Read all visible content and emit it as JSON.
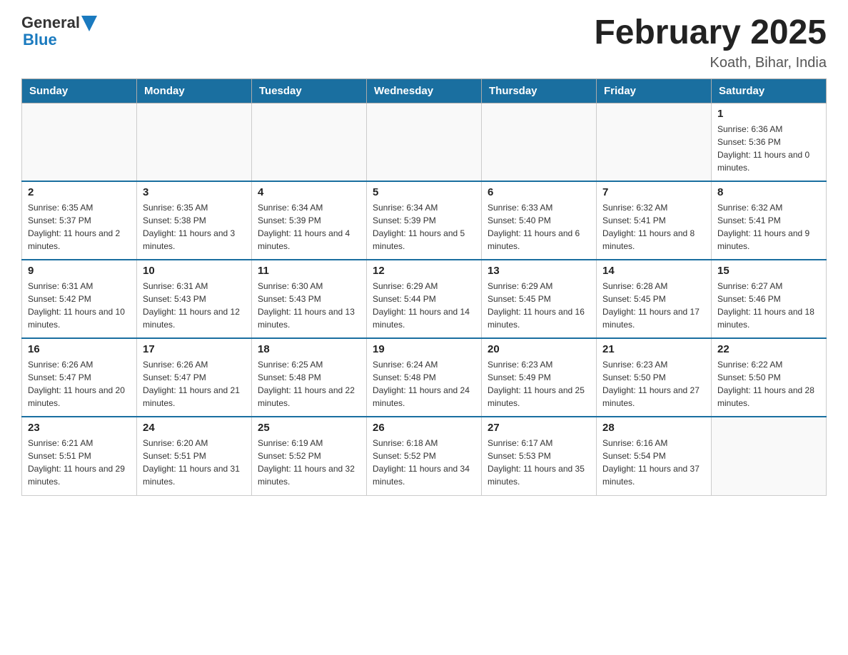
{
  "header": {
    "logo_general": "General",
    "logo_blue": "Blue",
    "month_title": "February 2025",
    "location": "Koath, Bihar, India"
  },
  "weekdays": [
    "Sunday",
    "Monday",
    "Tuesday",
    "Wednesday",
    "Thursday",
    "Friday",
    "Saturday"
  ],
  "weeks": [
    [
      {
        "day": "",
        "sunrise": "",
        "sunset": "",
        "daylight": ""
      },
      {
        "day": "",
        "sunrise": "",
        "sunset": "",
        "daylight": ""
      },
      {
        "day": "",
        "sunrise": "",
        "sunset": "",
        "daylight": ""
      },
      {
        "day": "",
        "sunrise": "",
        "sunset": "",
        "daylight": ""
      },
      {
        "day": "",
        "sunrise": "",
        "sunset": "",
        "daylight": ""
      },
      {
        "day": "",
        "sunrise": "",
        "sunset": "",
        "daylight": ""
      },
      {
        "day": "1",
        "sunrise": "Sunrise: 6:36 AM",
        "sunset": "Sunset: 5:36 PM",
        "daylight": "Daylight: 11 hours and 0 minutes."
      }
    ],
    [
      {
        "day": "2",
        "sunrise": "Sunrise: 6:35 AM",
        "sunset": "Sunset: 5:37 PM",
        "daylight": "Daylight: 11 hours and 2 minutes."
      },
      {
        "day": "3",
        "sunrise": "Sunrise: 6:35 AM",
        "sunset": "Sunset: 5:38 PM",
        "daylight": "Daylight: 11 hours and 3 minutes."
      },
      {
        "day": "4",
        "sunrise": "Sunrise: 6:34 AM",
        "sunset": "Sunset: 5:39 PM",
        "daylight": "Daylight: 11 hours and 4 minutes."
      },
      {
        "day": "5",
        "sunrise": "Sunrise: 6:34 AM",
        "sunset": "Sunset: 5:39 PM",
        "daylight": "Daylight: 11 hours and 5 minutes."
      },
      {
        "day": "6",
        "sunrise": "Sunrise: 6:33 AM",
        "sunset": "Sunset: 5:40 PM",
        "daylight": "Daylight: 11 hours and 6 minutes."
      },
      {
        "day": "7",
        "sunrise": "Sunrise: 6:32 AM",
        "sunset": "Sunset: 5:41 PM",
        "daylight": "Daylight: 11 hours and 8 minutes."
      },
      {
        "day": "8",
        "sunrise": "Sunrise: 6:32 AM",
        "sunset": "Sunset: 5:41 PM",
        "daylight": "Daylight: 11 hours and 9 minutes."
      }
    ],
    [
      {
        "day": "9",
        "sunrise": "Sunrise: 6:31 AM",
        "sunset": "Sunset: 5:42 PM",
        "daylight": "Daylight: 11 hours and 10 minutes."
      },
      {
        "day": "10",
        "sunrise": "Sunrise: 6:31 AM",
        "sunset": "Sunset: 5:43 PM",
        "daylight": "Daylight: 11 hours and 12 minutes."
      },
      {
        "day": "11",
        "sunrise": "Sunrise: 6:30 AM",
        "sunset": "Sunset: 5:43 PM",
        "daylight": "Daylight: 11 hours and 13 minutes."
      },
      {
        "day": "12",
        "sunrise": "Sunrise: 6:29 AM",
        "sunset": "Sunset: 5:44 PM",
        "daylight": "Daylight: 11 hours and 14 minutes."
      },
      {
        "day": "13",
        "sunrise": "Sunrise: 6:29 AM",
        "sunset": "Sunset: 5:45 PM",
        "daylight": "Daylight: 11 hours and 16 minutes."
      },
      {
        "day": "14",
        "sunrise": "Sunrise: 6:28 AM",
        "sunset": "Sunset: 5:45 PM",
        "daylight": "Daylight: 11 hours and 17 minutes."
      },
      {
        "day": "15",
        "sunrise": "Sunrise: 6:27 AM",
        "sunset": "Sunset: 5:46 PM",
        "daylight": "Daylight: 11 hours and 18 minutes."
      }
    ],
    [
      {
        "day": "16",
        "sunrise": "Sunrise: 6:26 AM",
        "sunset": "Sunset: 5:47 PM",
        "daylight": "Daylight: 11 hours and 20 minutes."
      },
      {
        "day": "17",
        "sunrise": "Sunrise: 6:26 AM",
        "sunset": "Sunset: 5:47 PM",
        "daylight": "Daylight: 11 hours and 21 minutes."
      },
      {
        "day": "18",
        "sunrise": "Sunrise: 6:25 AM",
        "sunset": "Sunset: 5:48 PM",
        "daylight": "Daylight: 11 hours and 22 minutes."
      },
      {
        "day": "19",
        "sunrise": "Sunrise: 6:24 AM",
        "sunset": "Sunset: 5:48 PM",
        "daylight": "Daylight: 11 hours and 24 minutes."
      },
      {
        "day": "20",
        "sunrise": "Sunrise: 6:23 AM",
        "sunset": "Sunset: 5:49 PM",
        "daylight": "Daylight: 11 hours and 25 minutes."
      },
      {
        "day": "21",
        "sunrise": "Sunrise: 6:23 AM",
        "sunset": "Sunset: 5:50 PM",
        "daylight": "Daylight: 11 hours and 27 minutes."
      },
      {
        "day": "22",
        "sunrise": "Sunrise: 6:22 AM",
        "sunset": "Sunset: 5:50 PM",
        "daylight": "Daylight: 11 hours and 28 minutes."
      }
    ],
    [
      {
        "day": "23",
        "sunrise": "Sunrise: 6:21 AM",
        "sunset": "Sunset: 5:51 PM",
        "daylight": "Daylight: 11 hours and 29 minutes."
      },
      {
        "day": "24",
        "sunrise": "Sunrise: 6:20 AM",
        "sunset": "Sunset: 5:51 PM",
        "daylight": "Daylight: 11 hours and 31 minutes."
      },
      {
        "day": "25",
        "sunrise": "Sunrise: 6:19 AM",
        "sunset": "Sunset: 5:52 PM",
        "daylight": "Daylight: 11 hours and 32 minutes."
      },
      {
        "day": "26",
        "sunrise": "Sunrise: 6:18 AM",
        "sunset": "Sunset: 5:52 PM",
        "daylight": "Daylight: 11 hours and 34 minutes."
      },
      {
        "day": "27",
        "sunrise": "Sunrise: 6:17 AM",
        "sunset": "Sunset: 5:53 PM",
        "daylight": "Daylight: 11 hours and 35 minutes."
      },
      {
        "day": "28",
        "sunrise": "Sunrise: 6:16 AM",
        "sunset": "Sunset: 5:54 PM",
        "daylight": "Daylight: 11 hours and 37 minutes."
      },
      {
        "day": "",
        "sunrise": "",
        "sunset": "",
        "daylight": ""
      }
    ]
  ]
}
